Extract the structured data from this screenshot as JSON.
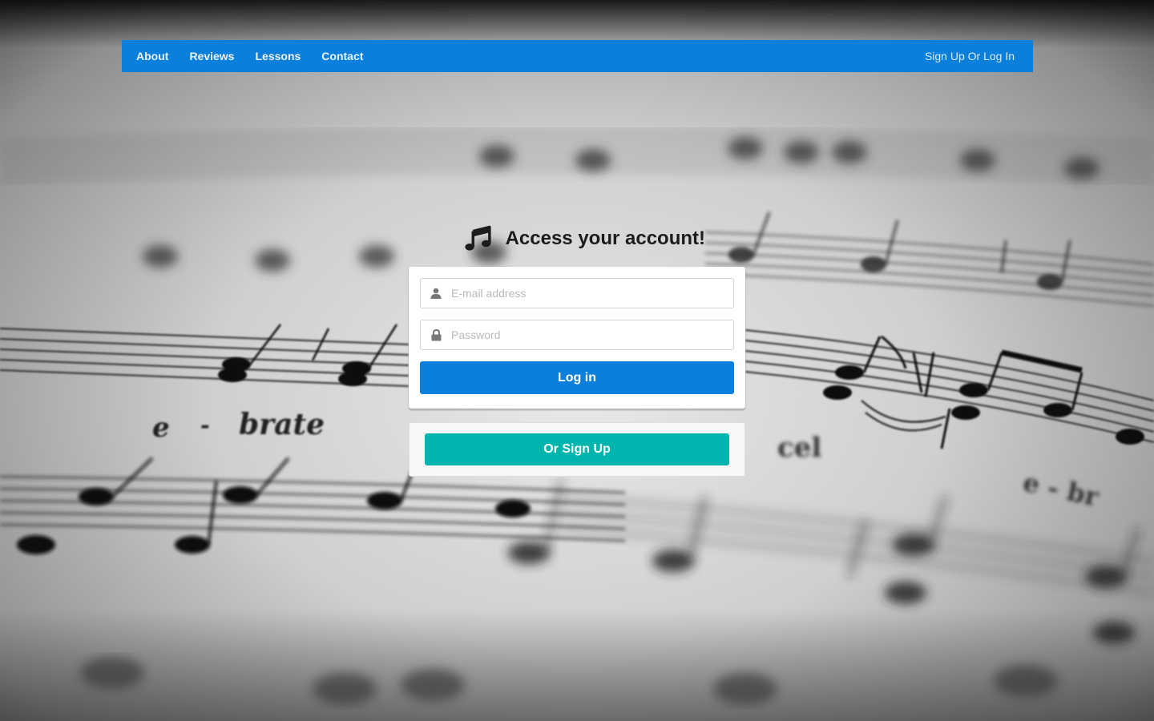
{
  "nav": {
    "links": [
      "About",
      "Reviews",
      "Lessons",
      "Contact"
    ],
    "account_link": "Sign Up Or Log In"
  },
  "login": {
    "title": "Access your account!",
    "header_icon": "music-note-icon",
    "email_placeholder": "E-mail address",
    "email_icon": "user-icon",
    "password_placeholder": "Password",
    "password_icon": "lock-icon",
    "submit_label": "Log in"
  },
  "signup": {
    "button_label": "Or Sign Up"
  },
  "background_text": [
    "e - brate",
    "cel",
    "e - br"
  ],
  "colors": {
    "primary": "#0b7fdc",
    "teal": "#00b5ad"
  }
}
